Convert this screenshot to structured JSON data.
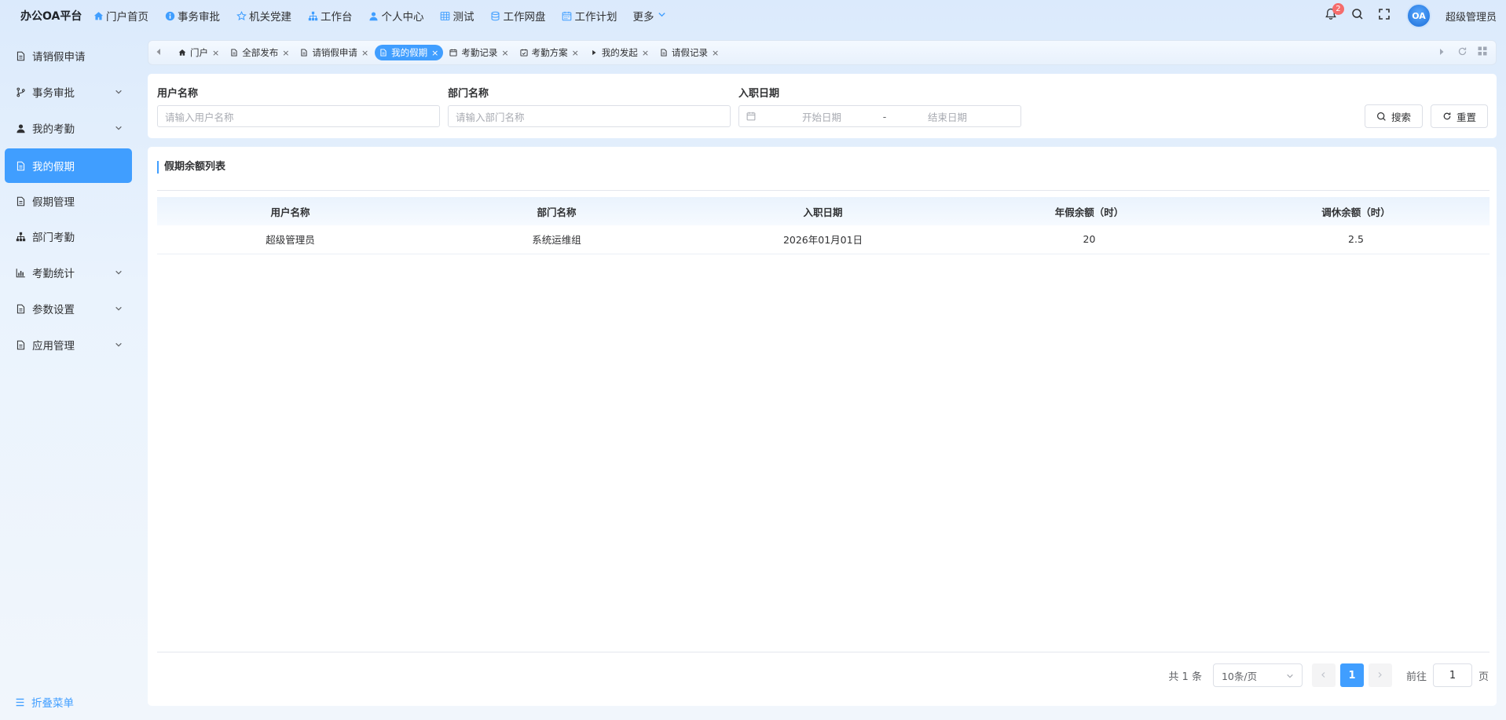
{
  "header": {
    "brand": "办公OA平台",
    "nav": [
      {
        "label": "门户首页",
        "icon": "home-icon"
      },
      {
        "label": "事务审批",
        "icon": "info-icon"
      },
      {
        "label": "机关党建",
        "icon": "star-icon"
      },
      {
        "label": "工作台",
        "icon": "org-chart-icon"
      },
      {
        "label": "个人中心",
        "icon": "user-icon"
      },
      {
        "label": "测试",
        "icon": "grid-icon"
      },
      {
        "label": "工作网盘",
        "icon": "database-icon"
      },
      {
        "label": "工作计划",
        "icon": "calendar-icon"
      },
      {
        "label": "更多",
        "icon": "chevron-down-icon"
      }
    ],
    "notification_count": "2",
    "avatar_text": "OA",
    "username": "超级管理员"
  },
  "sidebar": {
    "items": [
      {
        "label": "请销假申请",
        "icon": "document-icon"
      },
      {
        "label": "事务审批",
        "icon": "branch-icon"
      },
      {
        "label": "我的考勤",
        "icon": "user-icon"
      },
      {
        "label": "我的假期",
        "icon": "document-icon"
      },
      {
        "label": "假期管理",
        "icon": "document-icon"
      },
      {
        "label": "部门考勤",
        "icon": "org-chart-icon"
      },
      {
        "label": "考勤统计",
        "icon": "bar-chart-icon"
      },
      {
        "label": "参数设置",
        "icon": "document-icon"
      },
      {
        "label": "应用管理",
        "icon": "document-icon"
      }
    ],
    "active": "我的假期",
    "collapse_label": "折叠菜单"
  },
  "tabs": [
    {
      "label": "门户",
      "icon": "home-icon"
    },
    {
      "label": "全部发布",
      "icon": "document-icon"
    },
    {
      "label": "请销假申请",
      "icon": "document-icon"
    },
    {
      "label": "我的假期",
      "icon": "document-icon"
    },
    {
      "label": "考勤记录",
      "icon": "calendar-icon"
    },
    {
      "label": "考勤方案",
      "icon": "calendar-check-icon"
    },
    {
      "label": "我的发起",
      "icon": "caret-right-icon"
    },
    {
      "label": "请假记录",
      "icon": "document-icon"
    }
  ],
  "active_tab": "我的假期",
  "search": {
    "user_label": "用户名称",
    "user_placeholder": "请输入用户名称",
    "dept_label": "部门名称",
    "dept_placeholder": "请输入部门名称",
    "date_label": "入职日期",
    "date_start_placeholder": "开始日期",
    "date_separator": "-",
    "date_end_placeholder": "结束日期",
    "search_button": "搜索",
    "reset_button": "重置"
  },
  "table": {
    "title": "假期余额列表",
    "columns": [
      "用户名称",
      "部门名称",
      "入职日期",
      "年假余额（时）",
      "调休余额（时）"
    ],
    "rows": [
      [
        "超级管理员",
        "系统运维组",
        "2026年01月01日",
        "20",
        "2.5"
      ]
    ]
  },
  "pagination": {
    "total": "共 1 条",
    "page_size": "10条/页",
    "current_page": "1",
    "goto_label": "前往",
    "goto_value": "1",
    "page_unit": "页"
  },
  "colors": {
    "accent": "#409eff",
    "badge": "#f56c6c"
  }
}
